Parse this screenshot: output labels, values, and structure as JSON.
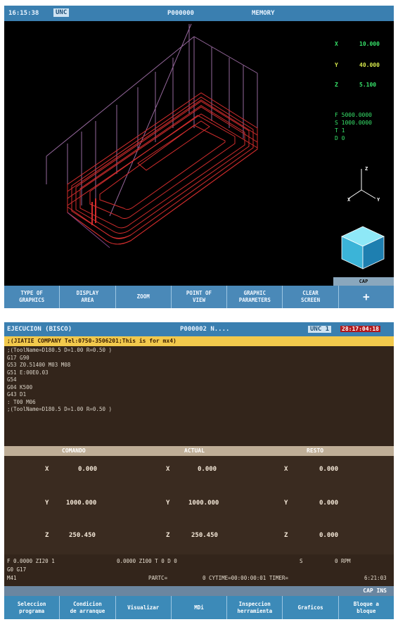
{
  "top_screen": {
    "title_bar": {
      "time": "16:15:38",
      "status_badge": "UNC",
      "file": "P000000",
      "mode": "MEMORY"
    },
    "coordinates": [
      {
        "axis": "X",
        "value": "10.000"
      },
      {
        "axis": "Y",
        "value": "40.000"
      },
      {
        "axis": "Z",
        "value": "5.100"
      }
    ],
    "feed_info": [
      "F 5000.0000",
      "S 1000.0000",
      "T  1",
      "D  0"
    ],
    "axis_triad": {
      "z": "Z",
      "x": "X",
      "y": "Y"
    },
    "cap_label": "CAP",
    "softkeys": [
      "TYPE OF\nGRAPHICS",
      "DISPLAY\nAREA",
      "ZOOM",
      "POINT OF\nVIEW",
      "GRAPHIC\nPARAMETERS",
      "CLEAR\nSCREEN",
      "+"
    ]
  },
  "bottom_screen": {
    "title_bar": {
      "mode": "EJECUCION (BISCO)",
      "file": "P000002 N....",
      "status_badge": "UNC 1",
      "time": "28:17:04:18"
    },
    "highlight_line": ";(JIATIE COMPANY Tel:0750-3506201;This is for mx4)",
    "program_lines": [
      ";(ToolName=D180.5 D=1.00 R=0.50 )",
      "G17 G90",
      "G53 Z0.51400 M03 M08",
      "G51  E:00E0.03",
      "G54",
      "G04 K500",
      "G43 D1",
      ": T00 M06",
      ";(ToolName=D180.5 D=1.00 R=0.50 )"
    ],
    "column_headers": [
      "COMANDO",
      "ACTUAL",
      "RESTO"
    ],
    "axes_rows": [
      {
        "axis": "X",
        "comando": "0.000",
        "actual": "0.000",
        "resto": "0.000"
      },
      {
        "axis": "Y",
        "comando": "1000.000",
        "actual": "1000.000",
        "resto": "0.000"
      },
      {
        "axis": "Z",
        "comando": "250.450",
        "actual": "250.450",
        "resto": "0.000"
      }
    ],
    "status_lines": {
      "line1_a": "F   0.0000 ZI20 1",
      "line1_b": "0.0000 Z100 T   0 D  0",
      "line1_c": "S",
      "line1_d": "0 RPM",
      "line2": "G0 G17",
      "line3_a": "M41",
      "line3_b": "PARTC=",
      "line3_c": "0 CYTIME=00:00:00:01 TIMER=",
      "line3_d": "6:21:03"
    },
    "cap_label": "CAP INS",
    "softkeys": [
      "Seleccion\nprograma",
      "Condicion\nde arranque",
      "Visualizar",
      "MDi",
      "Inspeccion\nherramienta",
      "Graficos",
      "Bloque a\nbloque"
    ]
  }
}
